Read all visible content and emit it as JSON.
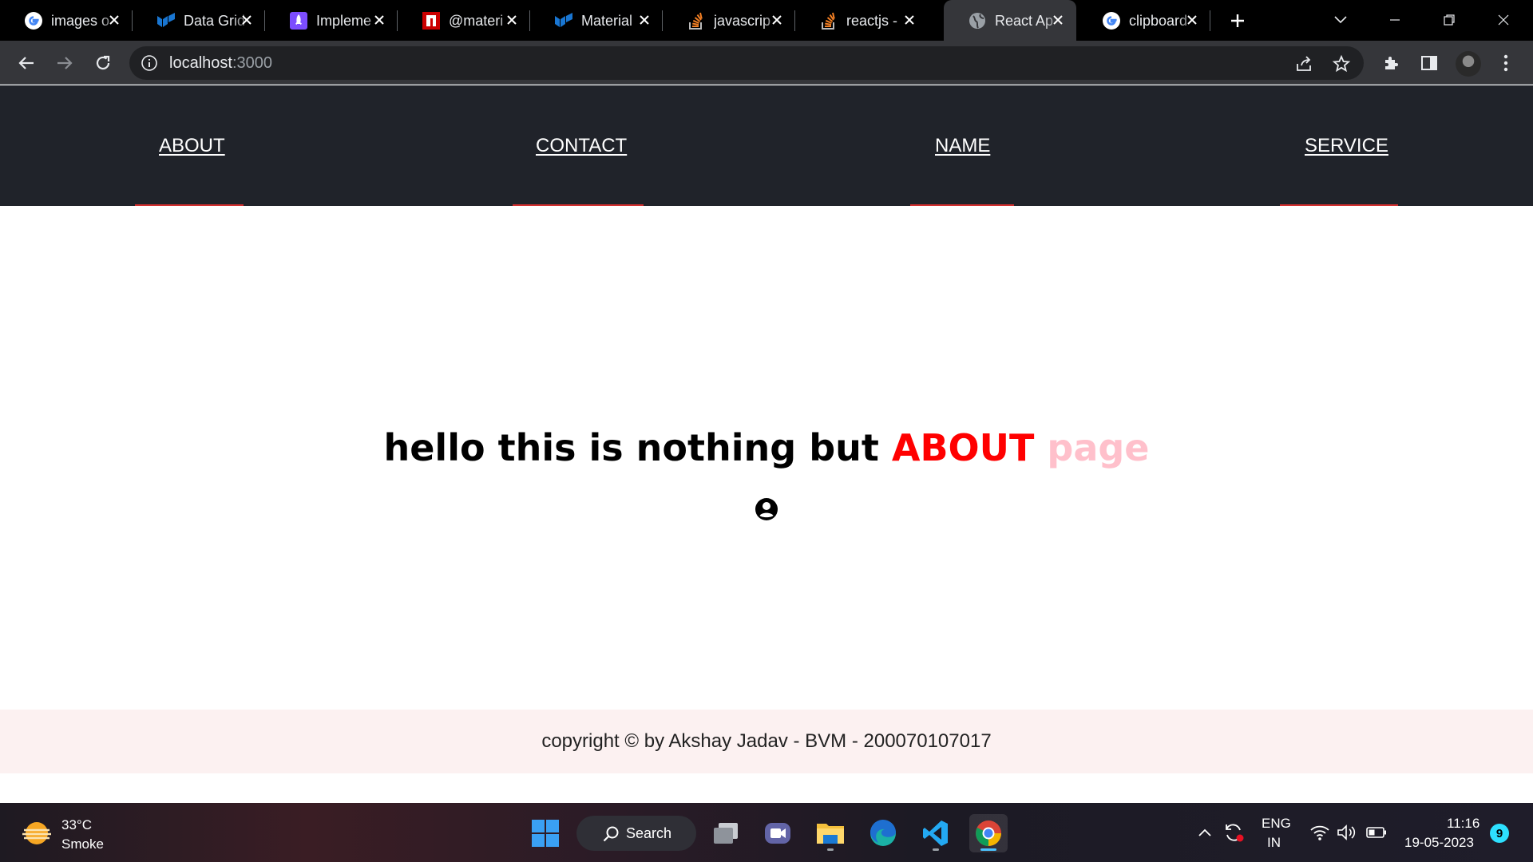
{
  "browser": {
    "tabs": [
      {
        "label": "images o",
        "icon": "google-icon"
      },
      {
        "label": "Data Grid",
        "icon": "mui-icon"
      },
      {
        "label": "Impleme",
        "icon": "rocket-icon"
      },
      {
        "label": "@materi",
        "icon": "npm-icon"
      },
      {
        "label": "Material",
        "icon": "mui-icon"
      },
      {
        "label": "javascrip",
        "icon": "stackoverflow-icon"
      },
      {
        "label": "reactjs -",
        "icon": "stackoverflow-icon"
      },
      {
        "label": "React Ap",
        "icon": "globe-icon",
        "active": true
      },
      {
        "label": "clipboard",
        "icon": "google-icon"
      }
    ],
    "url": {
      "host": "localhost",
      "port": ":3000"
    }
  },
  "app": {
    "nav": [
      {
        "label": "ABOUT"
      },
      {
        "label": "CONTACT"
      },
      {
        "label": "NAME"
      },
      {
        "label": "SERVICE"
      }
    ],
    "headline": {
      "prefix": "hello this is nothing but ",
      "highlight": "ABOUT",
      "suffix": "page"
    },
    "footer": "copyright © by Akshay Jadav - BVM - 200070107017",
    "colors": {
      "nav_bg": "#20232a",
      "highlight": "#ff0000",
      "suffix": "#ffc0cb",
      "footer_bg": "#fcf1f1",
      "nav_indicator": "#d32f2f"
    }
  },
  "taskbar": {
    "weather": {
      "temp": "33°C",
      "desc": "Smoke"
    },
    "search_label": "Search",
    "lang": {
      "line1": "ENG",
      "line2": "IN"
    },
    "time": "11:16",
    "date": "19-05-2023",
    "notifications": "9"
  }
}
